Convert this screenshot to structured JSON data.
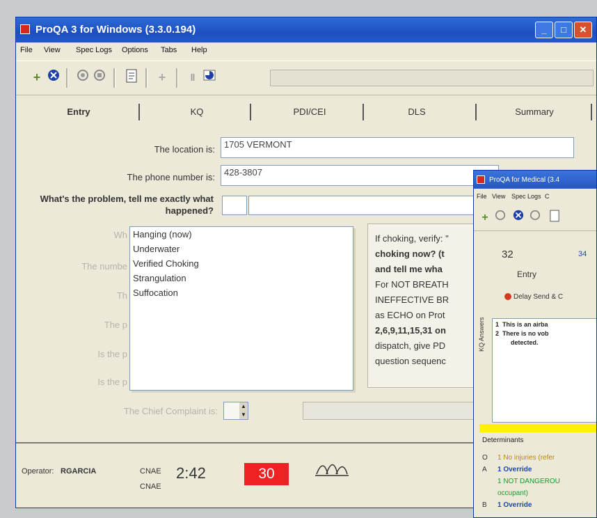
{
  "main_window": {
    "title": "ProQA 3 for Windows (3.3.0.194)",
    "menu": [
      "File",
      "View",
      "Spec Logs",
      "Options",
      "Tabs",
      "Help"
    ],
    "tabs": [
      "Entry",
      "KQ",
      "PDI/CEI",
      "DLS",
      "Summary"
    ],
    "form": {
      "location_label": "The location is:",
      "location_value": "1705 VERMONT",
      "phone_label": "The phone number is:",
      "phone_value": "428-3807",
      "question": "What's the problem, tell me exactly what happened?",
      "faded_labels": [
        "Wh",
        "The numbe",
        "Th",
        "The p",
        "Is the p",
        "Is the p"
      ],
      "chief_complaint_label": "The Chief Complaint is:"
    },
    "problem_list": [
      "Hanging (now)",
      "Underwater",
      "Verified Choking",
      "Strangulation",
      "Suffocation"
    ],
    "info_panel": [
      {
        "text": "If choking, verify: \"",
        "bold": false
      },
      {
        "text": "choking now? (t",
        "bold": true
      },
      {
        "text": "and tell me wha",
        "bold": true
      },
      {
        "text": "For NOT BREATH",
        "bold": false
      },
      {
        "text": "INEFFECTIVE BR",
        "bold": false
      },
      {
        "text": "as ECHO on Prot",
        "bold": false
      },
      {
        "text": "2,6,9,11,15,31 on",
        "bold": true
      },
      {
        "text": "dispatch, give PD",
        "bold": false
      },
      {
        "text": "question sequenc",
        "bold": false
      }
    ],
    "status": {
      "operator_label": "Operator:",
      "operator_name": "RGARCIA",
      "line1": "CNAE",
      "line2": "CNAE",
      "timer": "2:42",
      "counter": "30"
    }
  },
  "second_window": {
    "title": "ProQA for Medical (3.4",
    "menu": [
      "File",
      "View",
      "Spec Logs",
      "C"
    ],
    "case_number": "32",
    "case_number_2": "34",
    "tab_entry": "Entry",
    "delay_label": "Delay Send & C",
    "answers_label": "KQ Answers",
    "answers": [
      {
        "num": "1",
        "text": "This is an airba"
      },
      {
        "num": "2",
        "text": "There is no vob"
      },
      {
        "num": "",
        "text": "detected."
      }
    ],
    "determinants_label": "Determinants",
    "determinants": [
      {
        "level": "O",
        "text": "1 No injuries (refer",
        "color": "#b8860b"
      },
      {
        "level": "A",
        "text": "1 Override",
        "color": "#1a47b0"
      },
      {
        "level": "",
        "text": "1 NOT DANGEROU",
        "color": "#1a9a2a"
      },
      {
        "level": "",
        "text": "occupant)",
        "color": "#1a9a2a"
      },
      {
        "level": "B",
        "text": "1 Override",
        "color": "#1a47b0"
      }
    ]
  }
}
